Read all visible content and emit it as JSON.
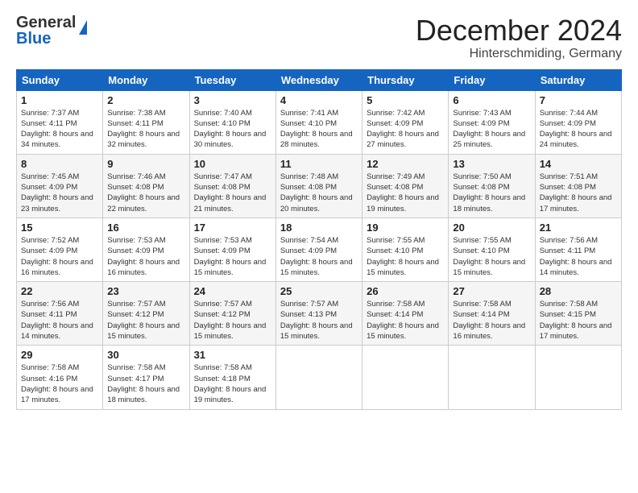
{
  "header": {
    "logo_general": "General",
    "logo_blue": "Blue",
    "month_title": "December 2024",
    "location": "Hinterschmiding, Germany"
  },
  "calendar": {
    "days_of_week": [
      "Sunday",
      "Monday",
      "Tuesday",
      "Wednesday",
      "Thursday",
      "Friday",
      "Saturday"
    ],
    "weeks": [
      [
        {
          "day": "1",
          "sunrise": "7:37 AM",
          "sunset": "4:11 PM",
          "daylight": "8 hours and 34 minutes."
        },
        {
          "day": "2",
          "sunrise": "7:38 AM",
          "sunset": "4:11 PM",
          "daylight": "8 hours and 32 minutes."
        },
        {
          "day": "3",
          "sunrise": "7:40 AM",
          "sunset": "4:10 PM",
          "daylight": "8 hours and 30 minutes."
        },
        {
          "day": "4",
          "sunrise": "7:41 AM",
          "sunset": "4:10 PM",
          "daylight": "8 hours and 28 minutes."
        },
        {
          "day": "5",
          "sunrise": "7:42 AM",
          "sunset": "4:09 PM",
          "daylight": "8 hours and 27 minutes."
        },
        {
          "day": "6",
          "sunrise": "7:43 AM",
          "sunset": "4:09 PM",
          "daylight": "8 hours and 25 minutes."
        },
        {
          "day": "7",
          "sunrise": "7:44 AM",
          "sunset": "4:09 PM",
          "daylight": "8 hours and 24 minutes."
        }
      ],
      [
        {
          "day": "8",
          "sunrise": "7:45 AM",
          "sunset": "4:09 PM",
          "daylight": "8 hours and 23 minutes."
        },
        {
          "day": "9",
          "sunrise": "7:46 AM",
          "sunset": "4:08 PM",
          "daylight": "8 hours and 22 minutes."
        },
        {
          "day": "10",
          "sunrise": "7:47 AM",
          "sunset": "4:08 PM",
          "daylight": "8 hours and 21 minutes."
        },
        {
          "day": "11",
          "sunrise": "7:48 AM",
          "sunset": "4:08 PM",
          "daylight": "8 hours and 20 minutes."
        },
        {
          "day": "12",
          "sunrise": "7:49 AM",
          "sunset": "4:08 PM",
          "daylight": "8 hours and 19 minutes."
        },
        {
          "day": "13",
          "sunrise": "7:50 AM",
          "sunset": "4:08 PM",
          "daylight": "8 hours and 18 minutes."
        },
        {
          "day": "14",
          "sunrise": "7:51 AM",
          "sunset": "4:08 PM",
          "daylight": "8 hours and 17 minutes."
        }
      ],
      [
        {
          "day": "15",
          "sunrise": "7:52 AM",
          "sunset": "4:09 PM",
          "daylight": "8 hours and 16 minutes."
        },
        {
          "day": "16",
          "sunrise": "7:53 AM",
          "sunset": "4:09 PM",
          "daylight": "8 hours and 16 minutes."
        },
        {
          "day": "17",
          "sunrise": "7:53 AM",
          "sunset": "4:09 PM",
          "daylight": "8 hours and 15 minutes."
        },
        {
          "day": "18",
          "sunrise": "7:54 AM",
          "sunset": "4:09 PM",
          "daylight": "8 hours and 15 minutes."
        },
        {
          "day": "19",
          "sunrise": "7:55 AM",
          "sunset": "4:10 PM",
          "daylight": "8 hours and 15 minutes."
        },
        {
          "day": "20",
          "sunrise": "7:55 AM",
          "sunset": "4:10 PM",
          "daylight": "8 hours and 15 minutes."
        },
        {
          "day": "21",
          "sunrise": "7:56 AM",
          "sunset": "4:11 PM",
          "daylight": "8 hours and 14 minutes."
        }
      ],
      [
        {
          "day": "22",
          "sunrise": "7:56 AM",
          "sunset": "4:11 PM",
          "daylight": "8 hours and 14 minutes."
        },
        {
          "day": "23",
          "sunrise": "7:57 AM",
          "sunset": "4:12 PM",
          "daylight": "8 hours and 15 minutes."
        },
        {
          "day": "24",
          "sunrise": "7:57 AM",
          "sunset": "4:12 PM",
          "daylight": "8 hours and 15 minutes."
        },
        {
          "day": "25",
          "sunrise": "7:57 AM",
          "sunset": "4:13 PM",
          "daylight": "8 hours and 15 minutes."
        },
        {
          "day": "26",
          "sunrise": "7:58 AM",
          "sunset": "4:14 PM",
          "daylight": "8 hours and 15 minutes."
        },
        {
          "day": "27",
          "sunrise": "7:58 AM",
          "sunset": "4:14 PM",
          "daylight": "8 hours and 16 minutes."
        },
        {
          "day": "28",
          "sunrise": "7:58 AM",
          "sunset": "4:15 PM",
          "daylight": "8 hours and 17 minutes."
        }
      ],
      [
        {
          "day": "29",
          "sunrise": "7:58 AM",
          "sunset": "4:16 PM",
          "daylight": "8 hours and 17 minutes."
        },
        {
          "day": "30",
          "sunrise": "7:58 AM",
          "sunset": "4:17 PM",
          "daylight": "8 hours and 18 minutes."
        },
        {
          "day": "31",
          "sunrise": "7:58 AM",
          "sunset": "4:18 PM",
          "daylight": "8 hours and 19 minutes."
        },
        null,
        null,
        null,
        null
      ]
    ]
  }
}
